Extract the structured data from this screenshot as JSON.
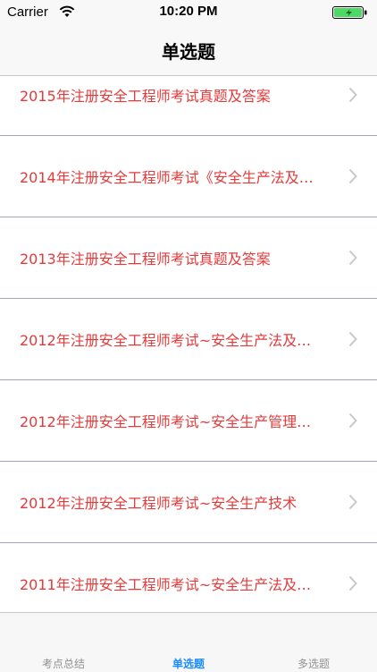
{
  "status_bar": {
    "carrier": "Carrier",
    "time": "10:20 PM",
    "battery_color": "#4cd964"
  },
  "nav": {
    "title": "单选题"
  },
  "list": {
    "items": [
      {
        "title": "2015年注册安全工程师考试真题及答案"
      },
      {
        "title": "2014年注册安全工程师考试《安全生产法及…"
      },
      {
        "title": "2013年注册安全工程师考试真题及答案"
      },
      {
        "title": "2012年注册安全工程师考试~安全生产法及…"
      },
      {
        "title": "2012年注册安全工程师考试~安全生产管理…"
      },
      {
        "title": "2012年注册安全工程师考试~安全生产技术"
      },
      {
        "title": "2011年注册安全工程师考试~安全生产法及…"
      }
    ]
  },
  "tabs": [
    {
      "label": "考点总结",
      "active": false
    },
    {
      "label": "单选题",
      "active": true
    },
    {
      "label": "多选题",
      "active": false
    }
  ],
  "colors": {
    "item_text": "#e33b3b",
    "tab_active": "#1a8cff",
    "tab_inactive": "#929292",
    "separator": "#9fa3ce"
  }
}
